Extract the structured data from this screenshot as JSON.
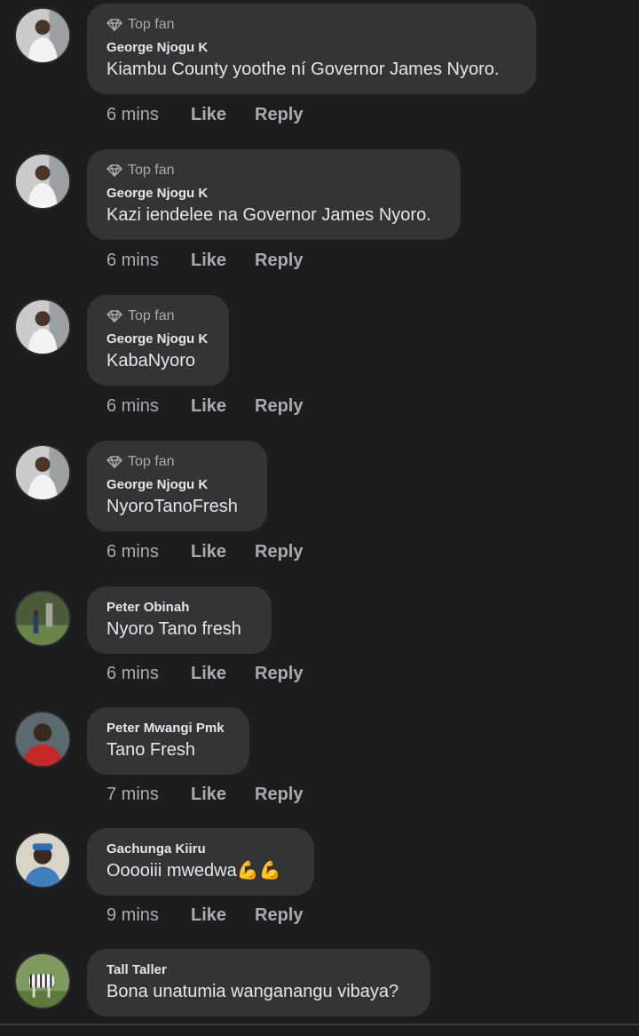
{
  "comments": [
    {
      "badge": "Top fan",
      "author": "George Njogu K",
      "text": "Kiambu County yoothe ní Governor James Nyoro.",
      "time": "6 mins",
      "like": "Like",
      "reply": "Reply",
      "avatar_color": "#8c8f93"
    },
    {
      "badge": "Top fan",
      "author": "George Njogu K",
      "text": "Kazi iendelee na Governor James Nyoro.",
      "time": "6 mins",
      "like": "Like",
      "reply": "Reply",
      "avatar_color": "#8c8f93"
    },
    {
      "badge": "Top fan",
      "author": "George Njogu K",
      "text": "KabaNyoro",
      "time": "6 mins",
      "like": "Like",
      "reply": "Reply",
      "avatar_color": "#8c8f93"
    },
    {
      "badge": "Top fan",
      "author": "George Njogu K",
      "text": "NyoroTanoFresh",
      "time": "6 mins",
      "like": "Like",
      "reply": "Reply",
      "avatar_color": "#8c8f93"
    },
    {
      "author": "Peter Obinah",
      "text": "Nyoro Tano fresh",
      "time": "6 mins",
      "like": "Like",
      "reply": "Reply",
      "avatar_color": "#4d5a3c"
    },
    {
      "author": "Peter Mwangi Pmk",
      "text": "Tano Fresh",
      "time": "7 mins",
      "like": "Like",
      "reply": "Reply",
      "avatar_color": "#9b2a2a"
    },
    {
      "author": "Gachunga Kiiru",
      "text": "Ooooiii mwedwa",
      "emoji": "💪💪",
      "time": "9 mins",
      "like": "Like",
      "reply": "Reply",
      "avatar_color": "#3d7fc1"
    },
    {
      "author": "Tall Taller",
      "text": "Bona unatumia wanganangu vibaya?",
      "avatar_color": "#6f8a5a"
    }
  ]
}
